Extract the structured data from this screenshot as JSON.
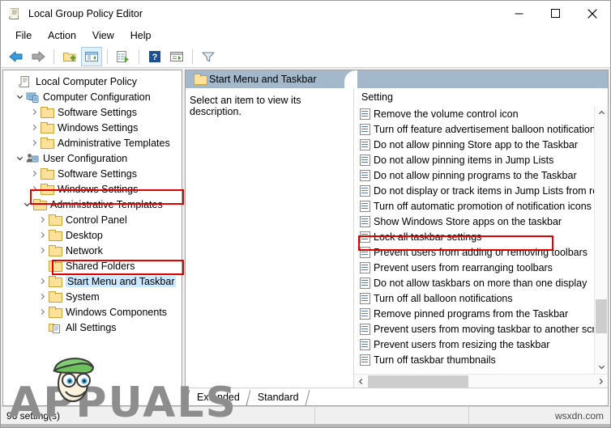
{
  "window": {
    "title": "Local Group Policy Editor",
    "icon": "policy-editor-icon",
    "controls": {
      "minimize": "minimize-icon",
      "maximize": "maximize-icon",
      "close": "close-icon"
    }
  },
  "menubar": {
    "items": [
      {
        "label": "File"
      },
      {
        "label": "Action"
      },
      {
        "label": "View"
      },
      {
        "label": "Help"
      }
    ]
  },
  "toolbar": {
    "buttons": [
      {
        "name": "back-icon"
      },
      {
        "name": "forward-icon"
      },
      {
        "name": "separator"
      },
      {
        "name": "up-folder-icon"
      },
      {
        "name": "show-hide-console-tree-icon"
      },
      {
        "name": "separator"
      },
      {
        "name": "export-list-icon"
      },
      {
        "name": "separator"
      },
      {
        "name": "help-icon"
      },
      {
        "name": "properties-icon"
      },
      {
        "name": "separator"
      },
      {
        "name": "filter-icon"
      }
    ]
  },
  "tree": {
    "nodes": [
      {
        "label": "Local Computer Policy",
        "depth": 0,
        "icon": "policy-icon",
        "toggle": "none",
        "selected": false
      },
      {
        "label": "Computer Configuration",
        "depth": 1,
        "icon": "computer-icon",
        "toggle": "expanded",
        "selected": false
      },
      {
        "label": "Software Settings",
        "depth": 2,
        "icon": "folder-icon",
        "toggle": "collapsed",
        "selected": false
      },
      {
        "label": "Windows Settings",
        "depth": 2,
        "icon": "folder-icon",
        "toggle": "collapsed",
        "selected": false
      },
      {
        "label": "Administrative Templates",
        "depth": 2,
        "icon": "folder-icon",
        "toggle": "collapsed",
        "selected": false
      },
      {
        "label": "User Configuration",
        "depth": 1,
        "icon": "user-icon",
        "toggle": "expanded",
        "selected": false
      },
      {
        "label": "Software Settings",
        "depth": 2,
        "icon": "folder-icon",
        "toggle": "collapsed",
        "selected": false
      },
      {
        "label": "Windows Settings",
        "depth": 2,
        "icon": "folder-icon",
        "toggle": "collapsed",
        "selected": false
      },
      {
        "label": "Administrative Templates",
        "depth": 2,
        "icon": "folder-icon",
        "toggle": "expanded",
        "selected": false
      },
      {
        "label": "Control Panel",
        "depth": 3,
        "icon": "folder-icon",
        "toggle": "collapsed",
        "selected": false
      },
      {
        "label": "Desktop",
        "depth": 3,
        "icon": "folder-icon",
        "toggle": "collapsed",
        "selected": false
      },
      {
        "label": "Network",
        "depth": 3,
        "icon": "folder-icon",
        "toggle": "collapsed",
        "selected": false
      },
      {
        "label": "Shared Folders",
        "depth": 3,
        "icon": "folder-icon",
        "toggle": "none",
        "selected": false
      },
      {
        "label": "Start Menu and Taskbar",
        "depth": 3,
        "icon": "folder-icon",
        "toggle": "collapsed",
        "selected": true
      },
      {
        "label": "System",
        "depth": 3,
        "icon": "folder-icon",
        "toggle": "collapsed",
        "selected": false
      },
      {
        "label": "Windows Components",
        "depth": 3,
        "icon": "folder-icon",
        "toggle": "collapsed",
        "selected": false
      },
      {
        "label": "All Settings",
        "depth": 3,
        "icon": "all-settings-icon",
        "toggle": "none",
        "selected": false
      }
    ]
  },
  "right_pane": {
    "header": {
      "title": "Start Menu and Taskbar",
      "icon": "folder-icon"
    },
    "description": "Select an item to view its description.",
    "list_header": "Setting",
    "settings": [
      {
        "label": "Remove the volume control icon",
        "highlighted": false
      },
      {
        "label": "Turn off feature advertisement balloon notifications",
        "highlighted": false
      },
      {
        "label": "Do not allow pinning Store app to the Taskbar",
        "highlighted": false
      },
      {
        "label": "Do not allow pinning items in Jump Lists",
        "highlighted": false
      },
      {
        "label": "Do not allow pinning programs to the Taskbar",
        "highlighted": false
      },
      {
        "label": "Do not display or track items in Jump Lists from remote locations",
        "highlighted": false
      },
      {
        "label": "Turn off automatic promotion of notification icons to the taskbar",
        "highlighted": false
      },
      {
        "label": "Show Windows Store apps on the taskbar",
        "highlighted": false
      },
      {
        "label": "Lock all taskbar settings",
        "highlighted": true
      },
      {
        "label": "Prevent users from adding or removing toolbars",
        "highlighted": false
      },
      {
        "label": "Prevent users from rearranging toolbars",
        "highlighted": false
      },
      {
        "label": "Do not allow taskbars on more than one display",
        "highlighted": false
      },
      {
        "label": "Turn off all balloon notifications",
        "highlighted": false
      },
      {
        "label": "Remove pinned programs from the Taskbar",
        "highlighted": false
      },
      {
        "label": "Prevent users from moving taskbar to another screen",
        "highlighted": false
      },
      {
        "label": "Prevent users from resizing the taskbar",
        "highlighted": false
      },
      {
        "label": "Turn off taskbar thumbnails",
        "highlighted": false
      }
    ]
  },
  "tabs": [
    {
      "label": "Extended",
      "active": true
    },
    {
      "label": "Standard",
      "active": false
    }
  ],
  "statusbar": {
    "count": "96 setting(s)",
    "watermark": "wsxdn.com"
  },
  "watermark": {
    "text": "APPUALS"
  },
  "colors": {
    "header_blue": "#a4b8cc",
    "selection_blue": "#cce8ff",
    "annotation_red": "#e00000",
    "folder_yellow": "#fde09a",
    "window_bg": "#f0f0f0"
  }
}
